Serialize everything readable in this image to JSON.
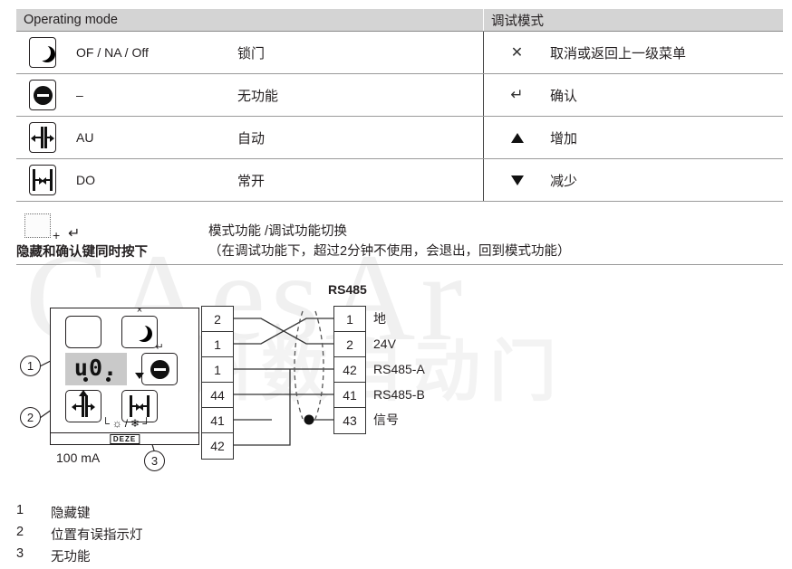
{
  "table": {
    "header_left": "Operating mode",
    "header_right": "调试模式",
    "rows": [
      {
        "icon": "moon-icon",
        "code": "OF / NA / Off",
        "desc": "锁门",
        "sym": "close-x-icon",
        "fn": "取消或返回上一级菜单"
      },
      {
        "icon": "no-function-icon",
        "code": "–",
        "desc": "无功能",
        "sym": "enter-icon",
        "fn": "确认"
      },
      {
        "icon": "door-auto-icon",
        "code": "AU",
        "desc": "自动",
        "sym": "arrow-up-icon",
        "fn": "增加"
      },
      {
        "icon": "door-open-icon",
        "code": "DO",
        "desc": "常开",
        "sym": "arrow-down-icon",
        "fn": "减少"
      }
    ]
  },
  "note": {
    "plus": "+",
    "enter_symbol": "↵",
    "press_text": "隐藏和确认键同时按下",
    "line1": "模式功能 /调试功能切换",
    "line2": "（在调试功能下，超过2分钟不使用，会退出，回到模式功能）"
  },
  "diagram": {
    "rs485_title": "RS485",
    "display_value": "u0.",
    "current_label": "100 mA",
    "logo_text": "DEZE",
    "key_marks": {
      "top_right": "×",
      "mid_right": "↵"
    },
    "left_terminals": [
      "2",
      "1",
      "1",
      "44",
      "41",
      "42"
    ],
    "right_terminals": [
      "1",
      "2",
      "42",
      "41",
      "43"
    ],
    "right_labels": [
      "地",
      "24V",
      "RS485-A",
      "RS485-B",
      "信号"
    ],
    "callouts": [
      "1",
      "2",
      "3"
    ]
  },
  "legend": {
    "items": [
      {
        "num": "1",
        "text": "隐藏键"
      },
      {
        "num": "2",
        "text": "位置有误指示灯"
      },
      {
        "num": "3",
        "text": "无功能"
      }
    ]
  },
  "watermark": {
    "latin": "CAesAr",
    "cjk": "广州数自动门"
  }
}
